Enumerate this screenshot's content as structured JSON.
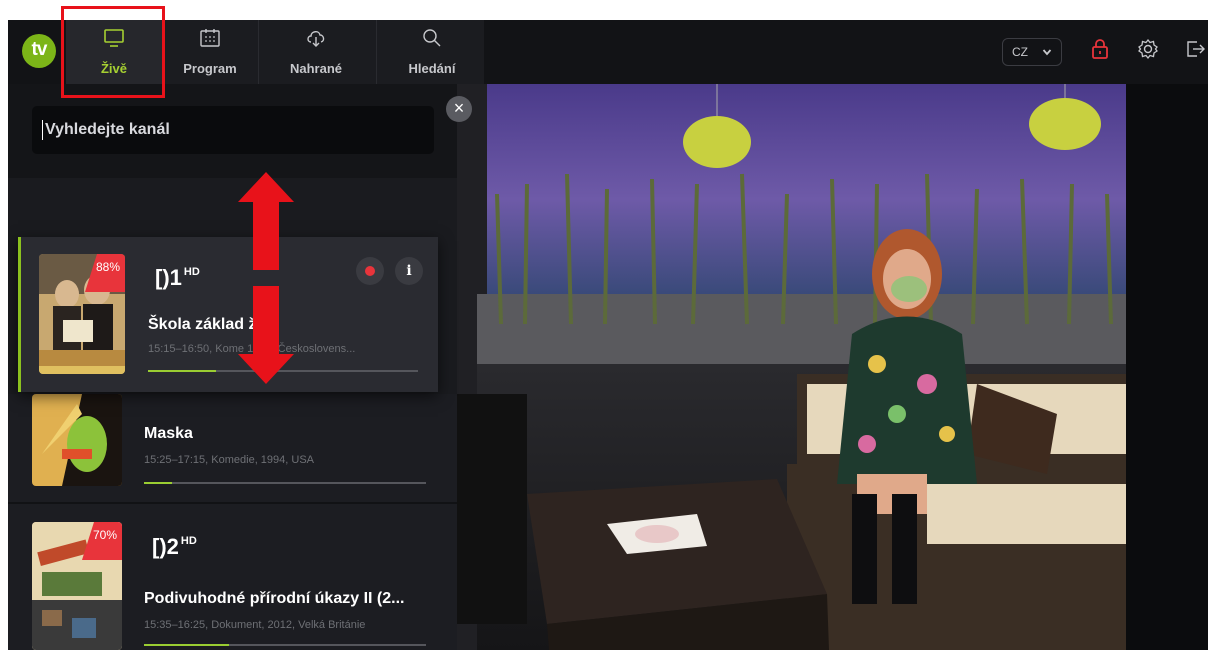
{
  "header": {
    "logo_text": "tv",
    "nav": [
      {
        "label": "Živě",
        "icon": "tv-icon",
        "active": true
      },
      {
        "label": "Program",
        "icon": "calendar-icon",
        "active": false
      },
      {
        "label": "Nahrané",
        "icon": "cloud-download-icon",
        "active": false
      },
      {
        "label": "Hledání",
        "icon": "search-icon",
        "active": false
      }
    ],
    "language": "CZ",
    "right_icons": [
      "lock-icon",
      "gear-icon",
      "logout-icon"
    ]
  },
  "search": {
    "placeholder": "Vyhledejte kanál"
  },
  "channels": [
    {
      "channel": "1",
      "hd": "HD",
      "percent": "88%",
      "title": "Škola základ života",
      "title_visible": "Škola základ ž   ta",
      "meta": "15:15–16:50, Kome    1938, Českoslovens...",
      "progress": 0.25,
      "active": true
    },
    {
      "channel": "",
      "hd": "",
      "percent": "",
      "title": "Maska",
      "meta": "15:25–17:15, Komedie, 1994, USA",
      "progress": 0.1,
      "active": false
    },
    {
      "channel": "2",
      "hd": "HD",
      "percent": "70%",
      "title": "Podivuhodné přírodní úkazy II (2...",
      "meta": "15:35–16:25, Dokument, 2012, Velká Británie",
      "progress": 0.3,
      "active": false
    }
  ],
  "colors": {
    "accent": "#9acd32",
    "record": "#e8343b",
    "annotation": "#e8121a"
  }
}
